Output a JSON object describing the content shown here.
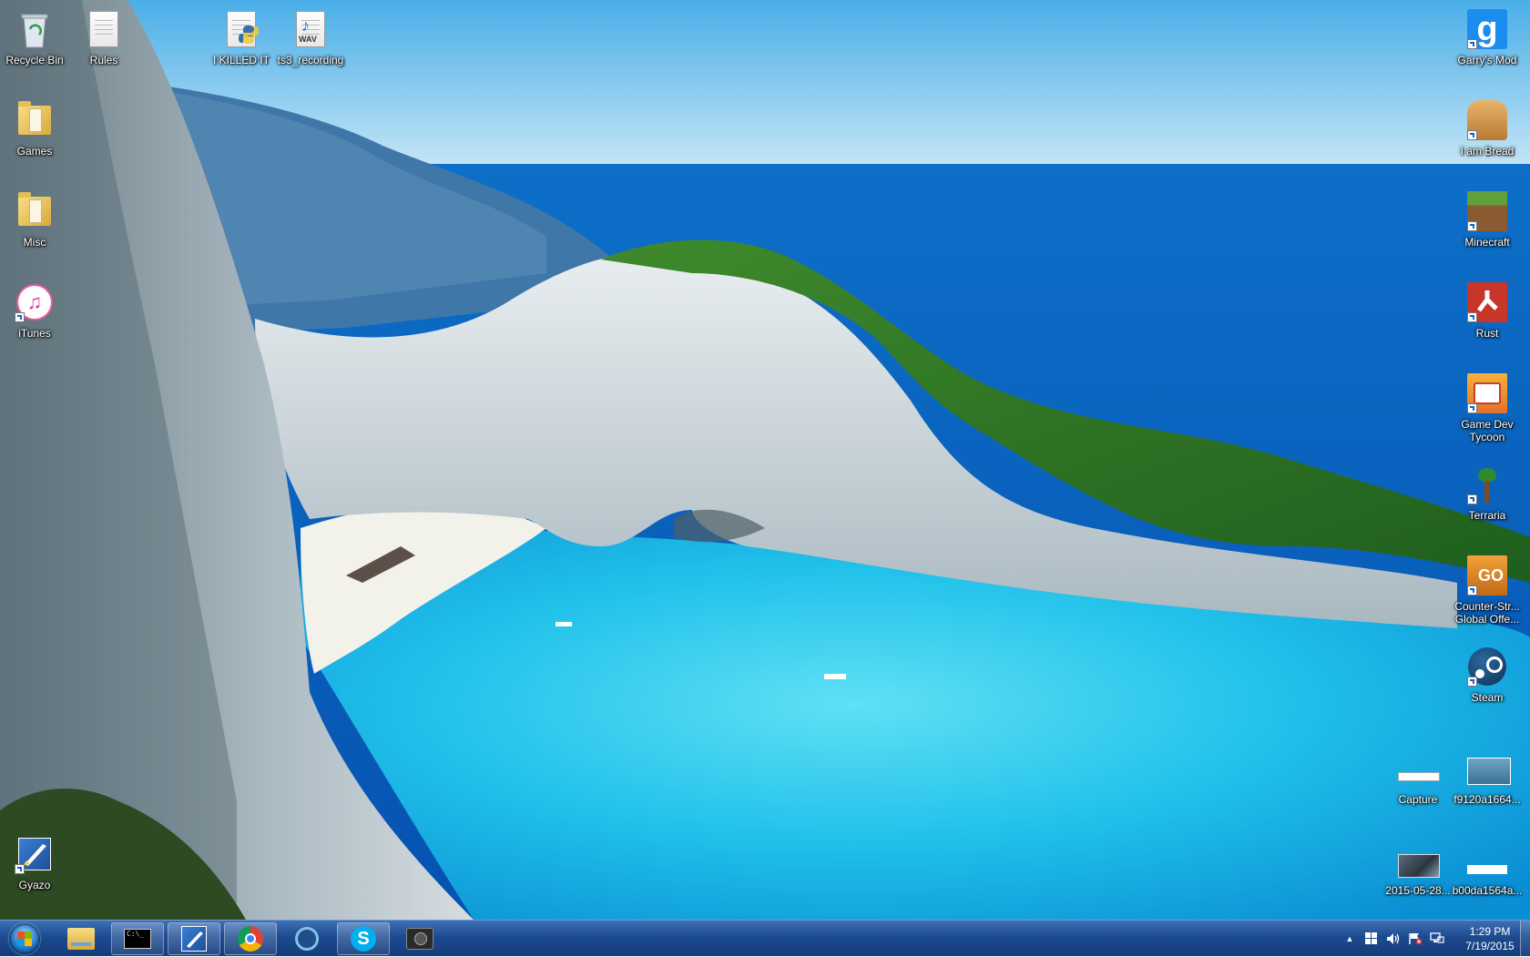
{
  "desktop": {
    "recycle_bin": "Recycle Bin",
    "rules": "Rules",
    "i_killed_it": "I KILLED IT",
    "ts3_recording": "ts3_recording",
    "wav_badge": "WAV",
    "games": "Games",
    "misc": "Misc",
    "itunes": "iTunes",
    "gyazo": "Gyazo",
    "garrys_mod": "Garry's Mod",
    "i_am_bread": "I am Bread",
    "minecraft": "Minecraft",
    "rust": "Rust",
    "game_dev_tycoon": "Game Dev Tycoon",
    "terraria": "Terraria",
    "csgo": "Counter-Str... Global Offe...",
    "csgo_badge": "GO",
    "steam": "Steam",
    "capture": "Capture",
    "f9120": "f9120a1664...",
    "screenshot_2015": "2015-05-28...",
    "b00da": "b00da1564a..."
  },
  "taskbar": {
    "clock_time": "1:29 PM",
    "clock_date": "7/19/2015",
    "tray_arrow": "▲"
  },
  "colors": {
    "taskbar": "#1d4b91",
    "sky": "#4aaee8",
    "lagoon": "#29c6ea"
  }
}
